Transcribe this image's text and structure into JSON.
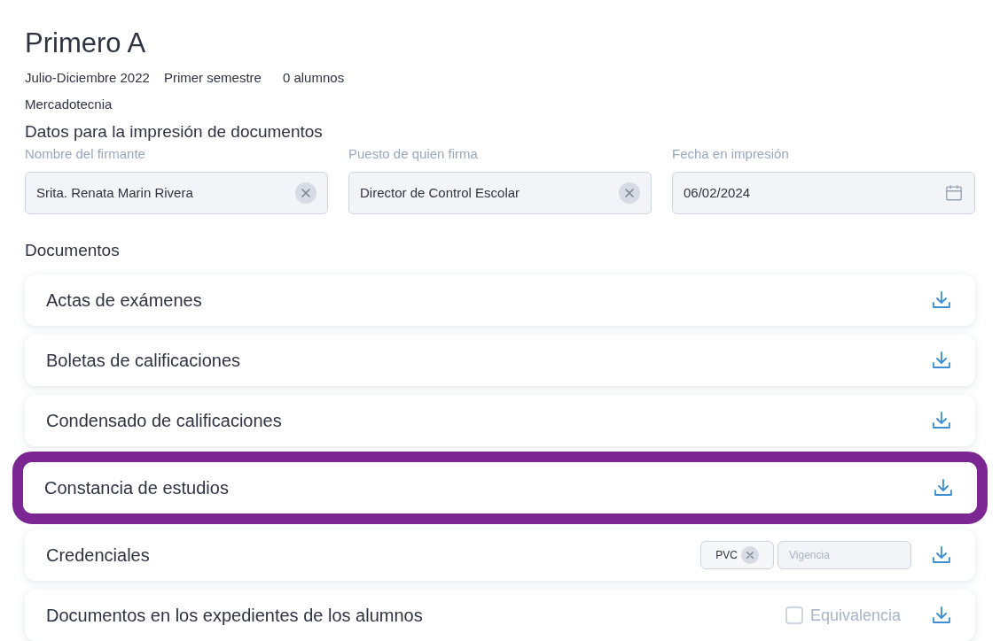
{
  "title": "Primero A",
  "meta": [
    "Julio-Diciembre 2022",
    "Primer semestre",
    "0 alumnos"
  ],
  "career": "Mercadotecnia",
  "print_section": {
    "heading": "Datos para la impresión de documentos",
    "fields": [
      {
        "kind": "clearable",
        "label": "Nombre del firmante",
        "value": "Srita. Renata Marin Rivera"
      },
      {
        "kind": "clearable",
        "label": "Puesto de quien firma",
        "value": "Director de Control Escolar"
      },
      {
        "kind": "date",
        "label": "Fecha en impresión",
        "value": "06/02/2024"
      }
    ]
  },
  "documents": {
    "heading": "Documentos",
    "rows": [
      {
        "kind": "plain",
        "label": "Actas de exámenes",
        "highlighted": false
      },
      {
        "kind": "plain",
        "label": "Boletas de calificaciones",
        "highlighted": false
      },
      {
        "kind": "plain",
        "label": "Condensado de calificaciones",
        "highlighted": false
      },
      {
        "kind": "plain",
        "label": "Constancia de estudios",
        "highlighted": true
      },
      {
        "kind": "credential",
        "label": "Credenciales",
        "highlighted": false,
        "tag": "PVC",
        "placeholder": "Vigencia"
      },
      {
        "kind": "checkbox",
        "label": "Documentos en los expedientes de los alumnos",
        "highlighted": false,
        "option": "Equivalencia",
        "checked": false
      }
    ]
  }
}
